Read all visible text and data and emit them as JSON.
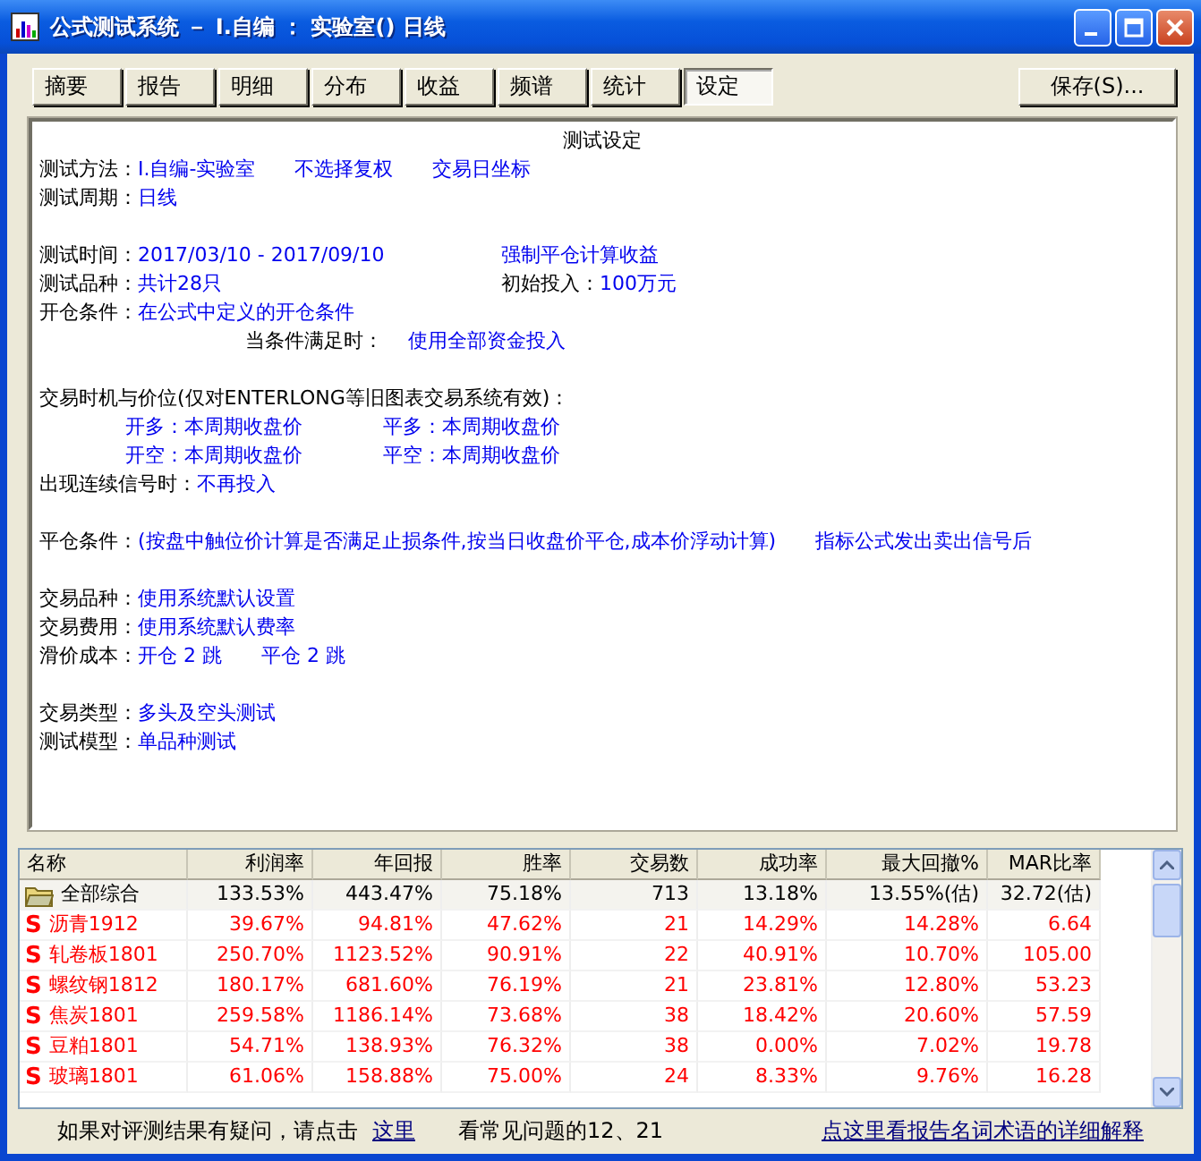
{
  "window": {
    "title": "公式测试系统 － I.自编 ： 实验室() 日线"
  },
  "tabs": [
    {
      "label": "摘要",
      "selected": false
    },
    {
      "label": "报告",
      "selected": false
    },
    {
      "label": "明细",
      "selected": false
    },
    {
      "label": "分布",
      "selected": false
    },
    {
      "label": "收益",
      "selected": false
    },
    {
      "label": "频谱",
      "selected": false
    },
    {
      "label": "统计",
      "selected": false
    },
    {
      "label": "设定",
      "selected": true
    }
  ],
  "save_button": "保存(S)...",
  "settings": {
    "heading": "测试设定",
    "lines": [
      {
        "kind": "plain",
        "parts": [
          {
            "text": "测试方法：",
            "kind": "label"
          },
          {
            "text": "I.自编-实验室",
            "kind": "value"
          },
          {
            "text": "不选择复权",
            "kind": "value"
          },
          {
            "text": "交易日坐标",
            "kind": "value"
          }
        ]
      },
      {
        "kind": "plain",
        "parts": [
          {
            "text": "测试周期：",
            "kind": "label"
          },
          {
            "text": "日线",
            "kind": "value"
          }
        ]
      },
      {
        "kind": "blank"
      },
      {
        "kind": "split",
        "groups": [
          [
            {
              "text": "测试时间：",
              "kind": "label"
            },
            {
              "text": "2017/03/10 - 2017/09/10",
              "kind": "value"
            }
          ],
          [
            {
              "text": "强制平仓计算收益",
              "kind": "value"
            }
          ]
        ]
      },
      {
        "kind": "split",
        "groups": [
          [
            {
              "text": "测试品种：",
              "kind": "label"
            },
            {
              "text": "共计28只",
              "kind": "value"
            }
          ],
          [
            {
              "text": "初始投入：",
              "kind": "label"
            },
            {
              "text": "100万元",
              "kind": "value"
            }
          ]
        ]
      },
      {
        "kind": "plain",
        "parts": [
          {
            "text": "开仓条件：",
            "kind": "label"
          },
          {
            "text": "在公式中定义的开仓条件",
            "kind": "value"
          }
        ]
      },
      {
        "kind": "indent",
        "parts": [
          {
            "text": "当条件满足时：",
            "kind": "label"
          },
          {
            "text": "使用全部资金投入",
            "kind": "value"
          }
        ]
      },
      {
        "kind": "blank"
      },
      {
        "kind": "plain",
        "parts": [
          {
            "text": "交易时机与价位(仅对ENTERLONG等旧图表交易系统有效)：",
            "kind": "label"
          }
        ]
      },
      {
        "kind": "indent-split",
        "groups": [
          [
            {
              "text": "开多：本周期收盘价",
              "kind": "value"
            }
          ],
          [
            {
              "text": "平多：本周期收盘价",
              "kind": "value"
            }
          ]
        ]
      },
      {
        "kind": "indent-split",
        "groups": [
          [
            {
              "text": "开空：本周期收盘价",
              "kind": "value"
            }
          ],
          [
            {
              "text": "平空：本周期收盘价",
              "kind": "value"
            }
          ]
        ]
      },
      {
        "kind": "plain",
        "parts": [
          {
            "text": "出现连续信号时：",
            "kind": "label"
          },
          {
            "text": "不再投入",
            "kind": "value"
          }
        ]
      },
      {
        "kind": "blank"
      },
      {
        "kind": "plain",
        "parts": [
          {
            "text": "平仓条件：",
            "kind": "label"
          },
          {
            "text": "(按盘中触位价计算是否满足止损条件,按当日收盘价平仓,成本价浮动计算)",
            "kind": "value"
          },
          {
            "text": "指标公式发出卖出信号后",
            "kind": "value"
          }
        ]
      },
      {
        "kind": "blank"
      },
      {
        "kind": "plain",
        "parts": [
          {
            "text": "交易品种：",
            "kind": "label"
          },
          {
            "text": "使用系统默认设置",
            "kind": "value"
          }
        ]
      },
      {
        "kind": "plain",
        "parts": [
          {
            "text": "交易费用：",
            "kind": "label"
          },
          {
            "text": "使用系统默认费率",
            "kind": "value"
          }
        ]
      },
      {
        "kind": "plain",
        "parts": [
          {
            "text": "滑价成本：",
            "kind": "label"
          },
          {
            "text": "开仓 2 跳",
            "kind": "value"
          },
          {
            "text": "平仓 2 跳",
            "kind": "value"
          }
        ]
      },
      {
        "kind": "blank"
      },
      {
        "kind": "plain",
        "parts": [
          {
            "text": "交易类型：",
            "kind": "label"
          },
          {
            "text": "多头及空头测试",
            "kind": "value"
          }
        ]
      },
      {
        "kind": "plain",
        "parts": [
          {
            "text": "测试模型：",
            "kind": "label"
          },
          {
            "text": "单品种测试",
            "kind": "value"
          }
        ]
      }
    ]
  },
  "table": {
    "columns": [
      "名称",
      "利润率",
      "年回报",
      "胜率",
      "交易数",
      "成功率",
      "最大回撤%",
      "MAR比率"
    ],
    "rows": [
      {
        "kind": "summary",
        "cells": [
          "全部综合",
          "133.53%",
          "443.47%",
          "75.18%",
          "713",
          "13.18%",
          "13.55%(估)",
          "32.72(估)"
        ]
      },
      {
        "kind": "instrument",
        "icon": "S",
        "cells": [
          "沥青1912",
          "39.67%",
          "94.81%",
          "47.62%",
          "21",
          "14.29%",
          "14.28%",
          "6.64"
        ]
      },
      {
        "kind": "instrument",
        "icon": "S",
        "cells": [
          "轧卷板1801",
          "250.70%",
          "1123.52%",
          "90.91%",
          "22",
          "40.91%",
          "10.70%",
          "105.00"
        ]
      },
      {
        "kind": "instrument",
        "icon": "S",
        "cells": [
          "螺纹钢1812",
          "180.17%",
          "681.60%",
          "76.19%",
          "21",
          "23.81%",
          "12.80%",
          "53.23"
        ]
      },
      {
        "kind": "instrument",
        "icon": "S",
        "cells": [
          "焦炭1801",
          "259.58%",
          "1186.14%",
          "73.68%",
          "38",
          "18.42%",
          "20.60%",
          "57.59"
        ]
      },
      {
        "kind": "instrument",
        "icon": "S",
        "cells": [
          "豆粕1801",
          "54.71%",
          "138.93%",
          "76.32%",
          "38",
          "0.00%",
          "7.02%",
          "19.78"
        ]
      },
      {
        "kind": "instrument",
        "icon": "S",
        "cells": [
          "玻璃1801",
          "61.06%",
          "158.88%",
          "75.00%",
          "24",
          "8.33%",
          "9.76%",
          "16.28"
        ]
      }
    ]
  },
  "footer": {
    "prompt": "如果对评测结果有疑问，请点击",
    "link": "这里",
    "note": "看常见问题的12、21",
    "help_link": "点这里看报告名词术语的详细解释"
  }
}
